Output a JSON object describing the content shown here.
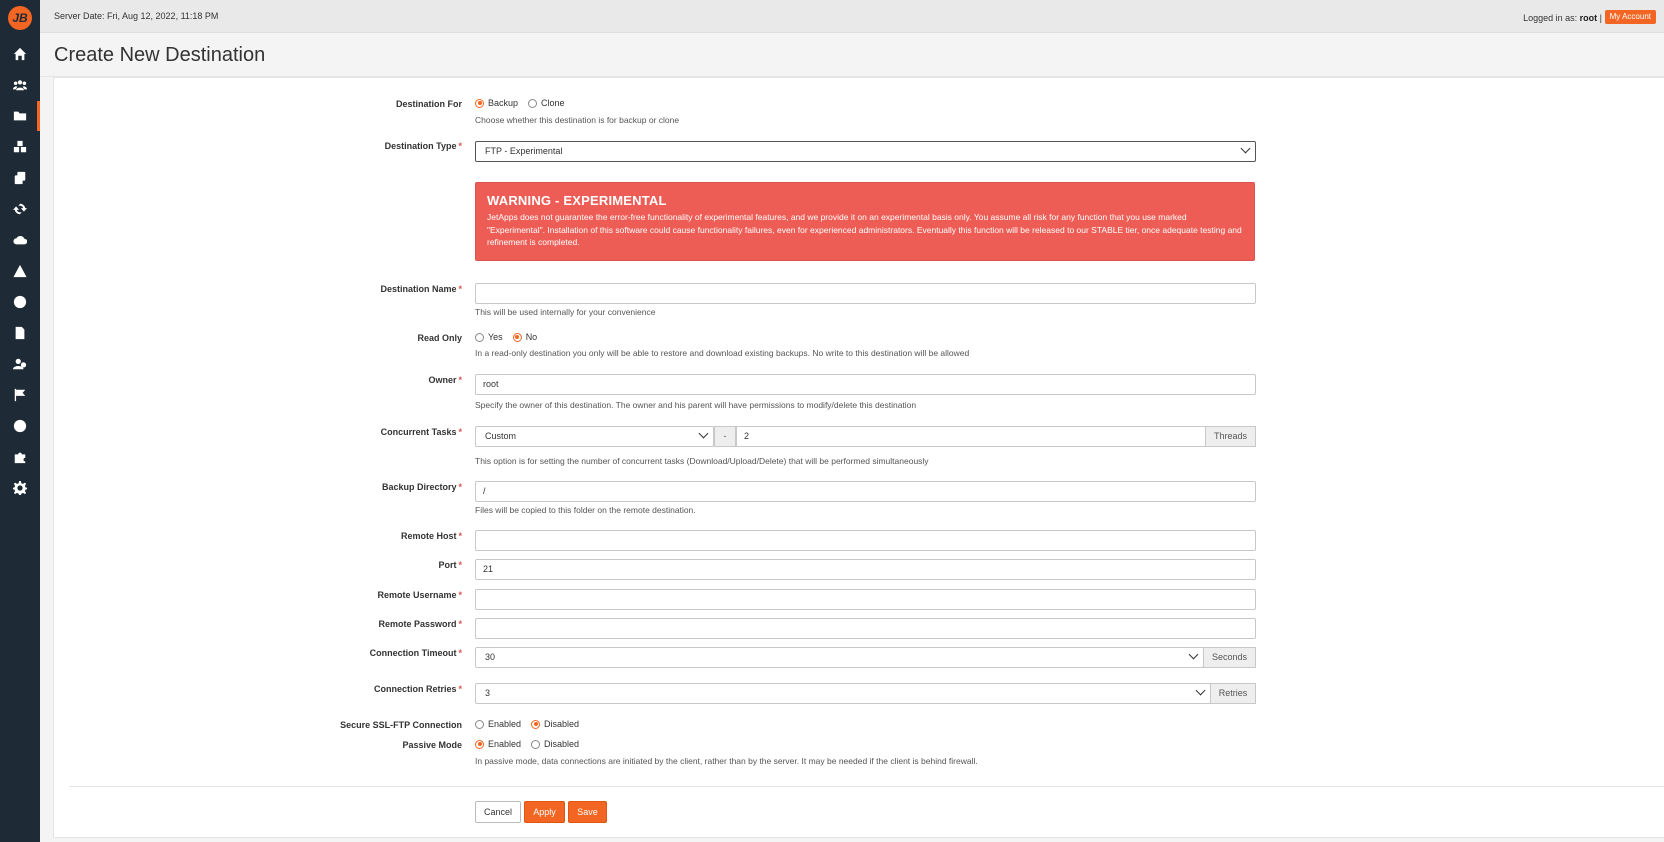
{
  "topbar": {
    "server_date": "Server Date: Fri, Aug 12, 2022, 11:18 PM",
    "logged_in_prefix": "Logged in as:",
    "username": "root",
    "separator": "|",
    "my_account": "My Account"
  },
  "page": {
    "title": "Create New Destination"
  },
  "sidebar": {
    "logo_glyph": "JB",
    "items": [
      {
        "icon": "home-icon"
      },
      {
        "icon": "users-icon"
      },
      {
        "icon": "folder-icon",
        "active": true
      },
      {
        "icon": "cubes-icon"
      },
      {
        "icon": "copy-icon"
      },
      {
        "icon": "refresh-icon"
      },
      {
        "icon": "cloud-download-icon"
      },
      {
        "icon": "warning-icon"
      },
      {
        "icon": "clock-icon"
      },
      {
        "icon": "file-icon"
      },
      {
        "icon": "user-group-icon"
      },
      {
        "icon": "flag-icon"
      },
      {
        "icon": "globe-icon"
      },
      {
        "icon": "puzzle-icon"
      },
      {
        "icon": "gear-icon"
      }
    ]
  },
  "form": {
    "destination_for": {
      "label": "Destination For",
      "options": [
        "Backup",
        "Clone"
      ],
      "selected": "Backup",
      "help": "Choose whether this destination is for backup or clone"
    },
    "destination_type": {
      "label": "Destination Type",
      "required": "*",
      "value": "FTP - Experimental"
    },
    "warning": {
      "title": "WARNING - EXPERIMENTAL",
      "body": "JetApps does not guarantee the error-free functionality of experimental features, and we provide it on an experimental basis only. You assume all risk for any function that you use marked \"Experimental\". Installation of this software could cause functionality failures, even for experienced administrators. Eventually this function will be released to our STABLE tier, once adequate testing and refinement is completed."
    },
    "destination_name": {
      "label": "Destination Name",
      "required": "*",
      "value": "",
      "help": "This will be used internally for your convenience"
    },
    "read_only": {
      "label": "Read Only",
      "options": [
        "Yes",
        "No"
      ],
      "selected": "No",
      "help": "In a read-only destination you only will be able to restore and download existing backups. No write to this destination will be allowed"
    },
    "owner": {
      "label": "Owner",
      "required": "*",
      "value": "root",
      "help": "Specify the owner of this destination. The owner and his parent will have permissions to modify/delete this destination"
    },
    "concurrent_tasks": {
      "label": "Concurrent Tasks",
      "required": "*",
      "mode": "Custom",
      "dash": "-",
      "value": "2",
      "unit": "Threads",
      "help": "This option is for setting the number of concurrent tasks (Download/Upload/Delete) that will be performed simultaneously"
    },
    "backup_directory": {
      "label": "Backup Directory",
      "required": "*",
      "value": "/",
      "help": "Files will be copied to this folder on the remote destination."
    },
    "remote_host": {
      "label": "Remote Host",
      "required": "*",
      "value": ""
    },
    "port": {
      "label": "Port",
      "required": "*",
      "value": "21"
    },
    "remote_username": {
      "label": "Remote Username",
      "required": "*",
      "value": ""
    },
    "remote_password": {
      "label": "Remote Password",
      "required": "*",
      "value": ""
    },
    "connection_timeout": {
      "label": "Connection Timeout",
      "required": "*",
      "value": "30",
      "unit": "Seconds"
    },
    "connection_retries": {
      "label": "Connection Retries",
      "required": "*",
      "value": "3",
      "unit": "Retries"
    },
    "secure_ssl": {
      "label": "Secure SSL-FTP Connection",
      "options": [
        "Enabled",
        "Disabled"
      ],
      "selected": "Disabled"
    },
    "passive_mode": {
      "label": "Passive Mode",
      "options": [
        "Enabled",
        "Disabled"
      ],
      "selected": "Enabled",
      "help": "In passive mode, data connections are initiated by the client, rather than by the server. It may be needed if the client is behind firewall."
    }
  },
  "buttons": {
    "cancel": "Cancel",
    "apply": "Apply",
    "save": "Save"
  },
  "colors": {
    "accent": "#f26522",
    "sidebar": "#1e2a35",
    "warning": "#ee5d55"
  }
}
